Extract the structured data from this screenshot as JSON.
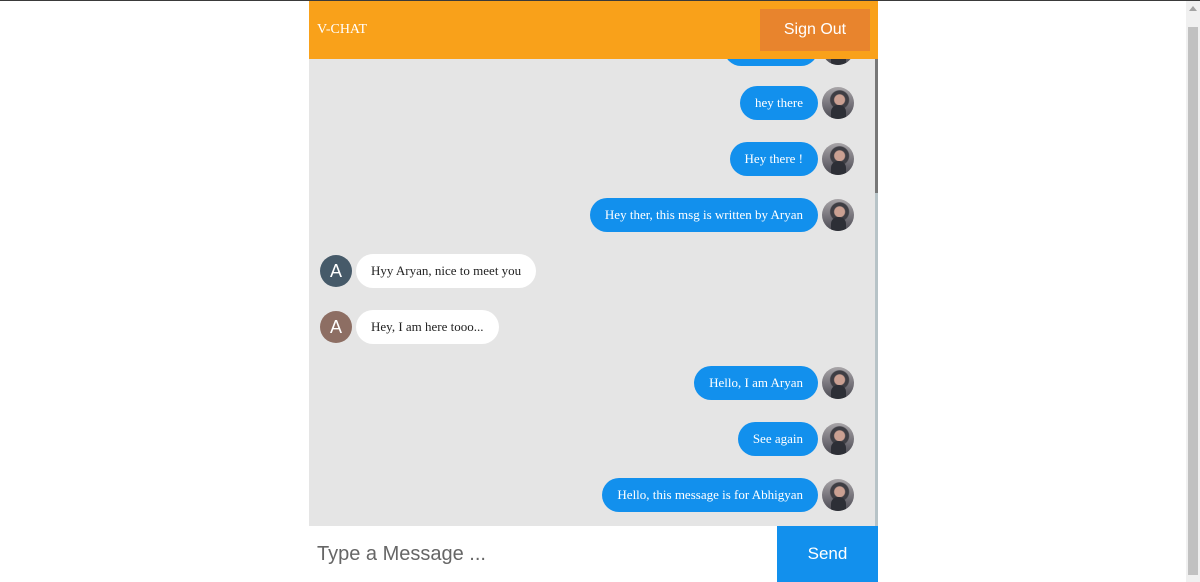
{
  "header": {
    "brand": "V-CHAT",
    "sign_out_label": "Sign Out"
  },
  "messages": [
    {
      "direction": "out",
      "text": "hey there"
    },
    {
      "direction": "out",
      "text": "Hey there !"
    },
    {
      "direction": "out",
      "text": "Hey ther, this msg is written by Aryan"
    },
    {
      "direction": "in",
      "text": "Hyy Aryan, nice to meet you",
      "initial": "A",
      "avatar_color": "#465a69"
    },
    {
      "direction": "in",
      "text": "Hey, I am here tooo...",
      "initial": "A",
      "avatar_color": "#8d6e63"
    },
    {
      "direction": "out",
      "text": "Hello, I am Aryan"
    },
    {
      "direction": "out",
      "text": "See again"
    },
    {
      "direction": "out",
      "text": "Hello, this message is for Abhigyan"
    }
  ],
  "composer": {
    "placeholder": "Type a Message ...",
    "send_label": "Send"
  },
  "colors": {
    "header": "#f9a11a",
    "sign_out": "#e8842d",
    "outgoing_bubble": "#1290ed",
    "send_button": "#1290ed",
    "chat_background": "#e5e5e5"
  }
}
